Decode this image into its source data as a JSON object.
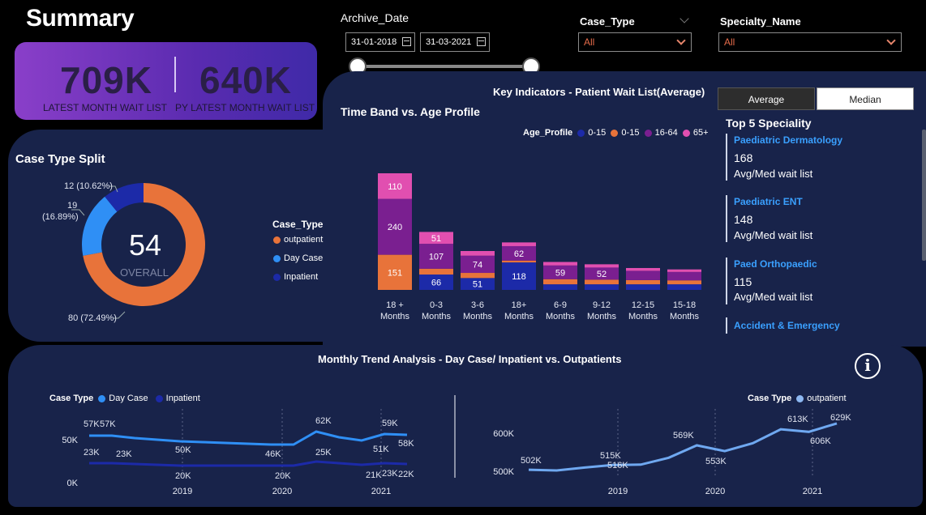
{
  "header": {
    "title": "Summary"
  },
  "kpi": {
    "latest_value": "709K",
    "latest_label": "LATEST MONTH WAIT LIST",
    "py_value": "640K",
    "py_label": "PY LATEST MONTH WAIT LIST"
  },
  "filters": {
    "archive_label": "Archive_Date",
    "date_from": "31-01-2018",
    "date_to": "31-03-2021",
    "case_type_label": "Case_Type",
    "case_type_value": "All",
    "specialty_label": "Specialty_Name",
    "specialty_value": "All"
  },
  "key_indicators": {
    "title": "Key Indicators - Patient Wait List(Average)",
    "average_btn": "Average",
    "median_btn": "Median"
  },
  "case_split": {
    "title": "Case Type Split",
    "center_value": "54",
    "center_label": "OVERALL",
    "labels": [
      "12 (10.62%)",
      "19",
      "(16.89%)",
      "80 (72.49%)"
    ],
    "legend_title": "Case_Type",
    "legend": [
      "outpatient",
      "Day Case",
      "Inpatient"
    ]
  },
  "colors": {
    "outpatient": "#e8733a",
    "day_case": "#2f8ff5",
    "inpatient": "#1c2aa8",
    "age_0_15_a": "#1c2aa8",
    "age_0_15_b": "#e8733a",
    "age_16_64": "#7a1f90",
    "age_65_plus": "#e14fb0",
    "link": "#3aa0ff"
  },
  "time_band": {
    "title": "Time Band vs. Age Profile",
    "legend_title": "Age_Profile",
    "legend": [
      "0-15",
      "0-15",
      "16-64",
      "65+"
    ]
  },
  "top5": {
    "title": "Top 5 Speciality",
    "items": [
      {
        "name": "Paediatric Dermatology",
        "value": "168",
        "sub": "Avg/Med wait list"
      },
      {
        "name": "Paediatric ENT",
        "value": "148",
        "sub": "Avg/Med wait list"
      },
      {
        "name": "Paed Orthopaedic",
        "value": "115",
        "sub": "Avg/Med wait list"
      },
      {
        "name": "Accident & Emergency"
      }
    ]
  },
  "monthly": {
    "title": "Monthly Trend Analysis - Day Case/ Inpatient vs. Outpatients",
    "left_legend_title": "Case Type",
    "left_legend": [
      "Day Case",
      "Inpatient"
    ],
    "right_legend_title": "Case Type",
    "right_legend": [
      "outpatient"
    ],
    "info_icon": "i"
  },
  "chart_data": [
    {
      "type": "pie",
      "title": "Case Type Split",
      "categories": [
        "outpatient",
        "Day Case",
        "Inpatient"
      ],
      "values": [
        80,
        19,
        12
      ],
      "percent": [
        72.49,
        16.89,
        10.62
      ]
    },
    {
      "type": "bar",
      "title": "Time Band vs. Age Profile",
      "stacked": true,
      "categories": [
        "18 + Months",
        "0-3 Months",
        "3-6 Months",
        "18+ Months",
        "6-9 Months",
        "9-12 Months",
        "12-15 Months",
        "15-18 Months"
      ],
      "category_lines": [
        [
          "18 +",
          "Months"
        ],
        [
          "0-3",
          "Months"
        ],
        [
          "3-6",
          "Months"
        ],
        [
          "18+",
          "Months"
        ],
        [
          "6-9",
          "Months"
        ],
        [
          "9-12",
          "Months"
        ],
        [
          "12-15",
          "Months"
        ],
        [
          "15-18",
          "Months"
        ]
      ],
      "series": [
        {
          "name": "0-15",
          "values": [
            0,
            66,
            51,
            118,
            24,
            24,
            24,
            24
          ],
          "labels": [
            "",
            "66",
            "51",
            "118",
            "",
            "",
            "",
            ""
          ]
        },
        {
          "name": "0-15",
          "values": [
            151,
            25,
            22,
            8,
            22,
            20,
            18,
            17
          ],
          "labels": [
            "151",
            "",
            "",
            "",
            "",
            "",
            "",
            ""
          ]
        },
        {
          "name": "16-64",
          "values": [
            240,
            107,
            74,
            62,
            59,
            52,
            40,
            36
          ],
          "labels": [
            "240",
            "107",
            "74",
            "62",
            "59",
            "52",
            "",
            ""
          ]
        },
        {
          "name": "65+",
          "values": [
            110,
            51,
            20,
            16,
            15,
            14,
            12,
            11
          ],
          "labels": [
            "110",
            "51",
            "",
            "",
            "",
            "",
            "",
            ""
          ]
        }
      ]
    },
    {
      "type": "line",
      "title": "Monthly Trend Analysis - Day Case/ Inpatient",
      "x_ticks": [
        "2019",
        "2020",
        "2021"
      ],
      "y_ticks": [
        "50K",
        "0K"
      ],
      "series": [
        {
          "name": "Day Case",
          "values": [
            57,
            57,
            54,
            52,
            50,
            49,
            48,
            47,
            46,
            46,
            62,
            55,
            51,
            59,
            58
          ],
          "labels": [
            "57K",
            "57K",
            "50K",
            "46K",
            "62K",
            "51K",
            "59K",
            "58K"
          ]
        },
        {
          "name": "Inpatient",
          "values": [
            23,
            23,
            22,
            21,
            20,
            20,
            20,
            20,
            20,
            20,
            25,
            23,
            21,
            23,
            22
          ],
          "labels": [
            "23K",
            "23K",
            "20K",
            "20K",
            "25K",
            "21K",
            "23K",
            "22K"
          ]
        }
      ]
    },
    {
      "type": "line",
      "title": "Monthly Trend Analysis - Outpatients",
      "x_ticks": [
        "2019",
        "2020",
        "2021"
      ],
      "y_ticks": [
        "600K",
        "500K"
      ],
      "series": [
        {
          "name": "outpatient",
          "values": [
            502,
            500,
            508,
            515,
            516,
            535,
            569,
            553,
            575,
            613,
            606,
            629
          ],
          "labels": [
            "502K",
            "515K",
            "516K",
            "569K",
            "553K",
            "613K",
            "606K",
            "629K"
          ]
        }
      ]
    }
  ]
}
